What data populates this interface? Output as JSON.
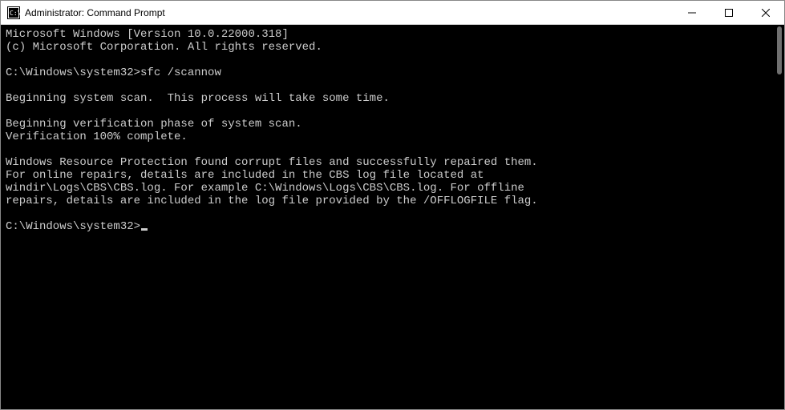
{
  "titlebar": {
    "title": "Administrator: Command Prompt"
  },
  "terminal": {
    "lines": [
      "Microsoft Windows [Version 10.0.22000.318]",
      "(c) Microsoft Corporation. All rights reserved.",
      "",
      "C:\\Windows\\system32>sfc /scannow",
      "",
      "Beginning system scan.  This process will take some time.",
      "",
      "Beginning verification phase of system scan.",
      "Verification 100% complete.",
      "",
      "Windows Resource Protection found corrupt files and successfully repaired them.",
      "For online repairs, details are included in the CBS log file located at",
      "windir\\Logs\\CBS\\CBS.log. For example C:\\Windows\\Logs\\CBS\\CBS.log. For offline",
      "repairs, details are included in the log file provided by the /OFFLOGFILE flag.",
      "",
      "C:\\Windows\\system32>"
    ],
    "prompt_path": "C:\\Windows\\system32>",
    "typed_command": "sfc /scannow"
  }
}
